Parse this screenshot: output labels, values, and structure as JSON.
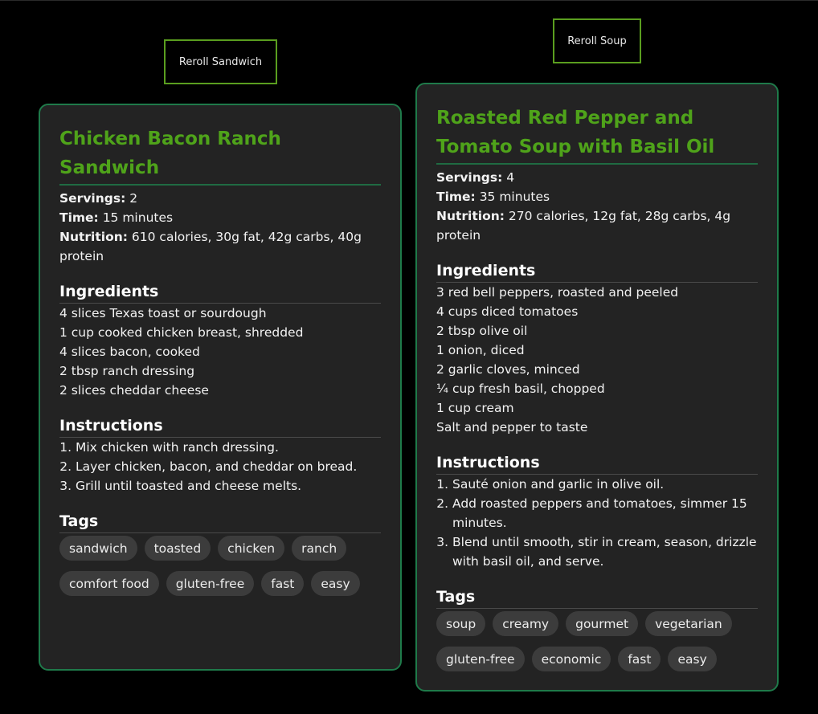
{
  "cards": [
    {
      "reroll_label": "Reroll Sandwich",
      "title": "Chicken Bacon Ranch Sandwich",
      "servings_label": "Servings:",
      "servings": "2",
      "time_label": "Time:",
      "time": "15 minutes",
      "nutrition_label": "Nutrition:",
      "nutrition": "610 calories, 30g fat, 42g carbs, 40g protein",
      "ingredients_heading": "Ingredients",
      "ingredients": [
        "4 slices Texas toast or sourdough",
        "1 cup cooked chicken breast, shredded",
        "4 slices bacon, cooked",
        "2 tbsp ranch dressing",
        "2 slices cheddar cheese"
      ],
      "instructions_heading": "Instructions",
      "instructions": [
        "Mix chicken with ranch dressing.",
        "Layer chicken, bacon, and cheddar on bread.",
        "Grill until toasted and cheese melts."
      ],
      "tags_heading": "Tags",
      "tags": [
        "sandwich",
        "toasted",
        "chicken",
        "ranch",
        "comfort food",
        "gluten-free",
        "fast",
        "easy"
      ]
    },
    {
      "reroll_label": "Reroll Soup",
      "title": "Roasted Red Pepper and Tomato Soup with Basil Oil",
      "servings_label": "Servings:",
      "servings": "4",
      "time_label": "Time:",
      "time": "35 minutes",
      "nutrition_label": "Nutrition:",
      "nutrition": "270 calories, 12g fat, 28g carbs, 4g protein",
      "ingredients_heading": "Ingredients",
      "ingredients": [
        "3 red bell peppers, roasted and peeled",
        "4 cups diced tomatoes",
        "2 tbsp olive oil",
        "1 onion, diced",
        "2 garlic cloves, minced",
        "¼ cup fresh basil, chopped",
        "1 cup cream",
        "Salt and pepper to taste"
      ],
      "instructions_heading": "Instructions",
      "instructions": [
        "Sauté onion and garlic in olive oil.",
        "Add roasted peppers and tomatoes, simmer 15 minutes.",
        "Blend until smooth, stir in cream, season, drizzle with basil oil, and serve."
      ],
      "tags_heading": "Tags",
      "tags": [
        "soup",
        "creamy",
        "gourmet",
        "vegetarian",
        "gluten-free",
        "economic",
        "fast",
        "easy"
      ]
    }
  ],
  "colors": {
    "background": "#000000",
    "card_background": "#232323",
    "card_border": "#1f7a4a",
    "title_green": "#4fa31a",
    "button_border": "#5a9e1f",
    "tag_background": "#3c3c3c"
  }
}
